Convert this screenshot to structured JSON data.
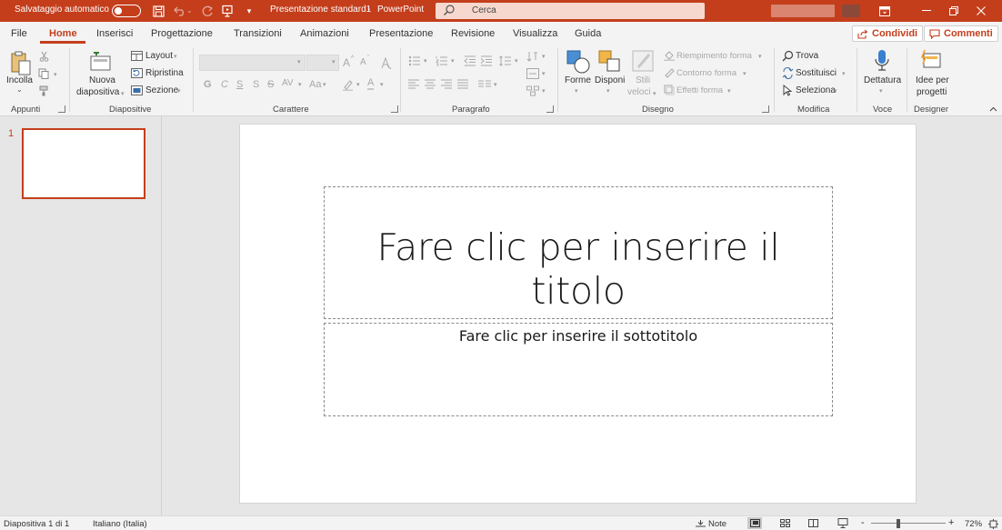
{
  "titlebar": {
    "autosave_label": "Salvataggio automatico",
    "doc_title": "Presentazione standard1",
    "separator": "-",
    "app_name": "PowerPoint",
    "search_placeholder": "Cerca",
    "icons": [
      "save-icon",
      "undo-icon",
      "redo-icon",
      "present-icon",
      "customize-icon",
      "search-icon",
      "ribbon-display-icon",
      "minimize-icon",
      "restore-icon",
      "close-icon"
    ]
  },
  "tabs": {
    "items": [
      {
        "label": "File"
      },
      {
        "label": "Home"
      },
      {
        "label": "Inserisci"
      },
      {
        "label": "Progettazione"
      },
      {
        "label": "Transizioni"
      },
      {
        "label": "Animazioni"
      },
      {
        "label": "Presentazione"
      },
      {
        "label": "Revisione"
      },
      {
        "label": "Visualizza"
      },
      {
        "label": "Guida"
      }
    ],
    "active": "Home",
    "share_label": "Condividi",
    "comments_label": "Commenti"
  },
  "ribbon": {
    "clipboard": {
      "paste": "Incolla",
      "group": "Appunti"
    },
    "slides": {
      "new_line1": "Nuova",
      "new_line2": "diapositiva",
      "layout": "Layout",
      "reset": "Ripristina",
      "section": "Sezione",
      "group": "Diapositive"
    },
    "font": {
      "bold": "G",
      "italic": "C",
      "underline": "S",
      "strike": "S",
      "spacing": "AV",
      "case": "Aa",
      "grow": "A",
      "shrink": "A",
      "group": "Carattere"
    },
    "paragraph": {
      "group": "Paragrafo"
    },
    "drawing": {
      "shapes": "Forme",
      "arrange": "Disponi",
      "styles_line1": "Stili",
      "styles_line2": "veloci",
      "fill": "Riempimento forma",
      "outline": "Contorno forma",
      "effects": "Effetti forma",
      "group": "Disegno"
    },
    "editing": {
      "find": "Trova",
      "replace": "Sostituisci",
      "select": "Seleziona",
      "group": "Modifica"
    },
    "voice": {
      "dictate": "Dettatura",
      "group": "Voce"
    },
    "designer": {
      "ideas_line1": "Idee per",
      "ideas_line2": "progetti",
      "group": "Designer"
    }
  },
  "thumbnails": {
    "slide_number": "1"
  },
  "slide": {
    "title_placeholder": "Fare clic per inserire il titolo",
    "subtitle_placeholder": "Fare clic per inserire il sottotitolo"
  },
  "statusbar": {
    "slide_info": "Diapositiva 1 di 1",
    "language": "Italiano (Italia)",
    "notes": "Note",
    "zoom_minus": "-",
    "zoom_plus": "+",
    "zoom": "72%",
    "zoom_level": 0.37
  },
  "colors": {
    "accent": "#c43e1c",
    "ribbon": "#f3f3f3",
    "workspace": "#e6e6e6"
  }
}
